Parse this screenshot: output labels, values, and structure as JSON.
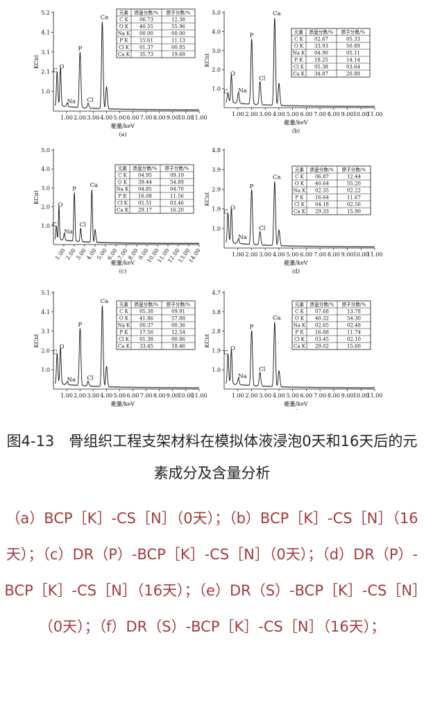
{
  "figure": {
    "title": "图4-13　骨组织工程支架材料在模拟体液浸泡0天和16天后的元素成分及含量分析",
    "subcaption": "（a）BCP［K］-CS［N］（0天）；（b）BCP［K］-CS［N］（16天）；（c）DR（P）-BCP［K］-CS［N］（0天）；（d）DR（P）-BCP［K］-CS［N］（16天）；（e）DR（S）-BCP［K］-CS［N］（0天）；（f）DR（S）-BCP［K］-CS［N］（16天）；"
  },
  "colors": {
    "ink": "#111111",
    "caption_sub": "#a33a3e",
    "caption_title": "#222222"
  },
  "chart_data": [
    {
      "type": "line",
      "panel": "(a)",
      "ylabel": "KCnt",
      "xlabel": "能量/keV",
      "yticks": [
        "5.2",
        "4.1",
        "3.1",
        "2.1",
        "1.0"
      ],
      "ylim": [
        0,
        5.2
      ],
      "xticks": [
        "1.00",
        "2.00",
        "3.00",
        "4.00",
        "5.00",
        "6.00",
        "7.00",
        "8.00",
        "9.00",
        "10.00",
        "11.00"
      ],
      "xlim": [
        0,
        11
      ],
      "peaks": [
        {
          "label": "C",
          "x": 0.28,
          "y": 1.9
        },
        {
          "label": "O",
          "x": 0.53,
          "y": 2.1
        },
        {
          "label": "Na",
          "x": 1.04,
          "y": 0.28
        },
        {
          "label": "P",
          "x": 2.01,
          "y": 3.05
        },
        {
          "label": "Cl",
          "x": 2.62,
          "y": 0.35
        },
        {
          "label": "Ca",
          "x": 3.69,
          "y": 4.7
        }
      ],
      "table": {
        "headers": [
          "元素",
          "质量分数/%",
          "原子分数/%"
        ],
        "rows": [
          [
            "C K",
            "06.73",
            "12.38"
          ],
          [
            "O K",
            "40.55",
            "55.96"
          ],
          [
            "Na K",
            "00.00",
            "00.00"
          ],
          [
            "P K",
            "15.61",
            "11.13"
          ],
          [
            "Cl K",
            "01.37",
            "00.85"
          ],
          [
            "Ca K",
            "35.73",
            "19.68"
          ]
        ]
      }
    },
    {
      "type": "line",
      "panel": "(b)",
      "ylabel": "KCnt",
      "xlabel": "能量/keV",
      "yticks": [
        "5.0",
        "4.0",
        "3.0",
        "2.0",
        "1.0"
      ],
      "ylim": [
        0,
        5.0
      ],
      "xticks": [
        "1.00",
        "2.00",
        "3.00",
        "4.00",
        "5.00",
        "6.00",
        "7.00",
        "8.00",
        "9.00",
        "10.00",
        "11.00"
      ],
      "xlim": [
        0,
        11
      ],
      "peaks": [
        {
          "label": "C",
          "x": 0.28,
          "y": 0.6
        },
        {
          "label": "O",
          "x": 0.53,
          "y": 1.55
        },
        {
          "label": "Na",
          "x": 1.04,
          "y": 0.65
        },
        {
          "label": "P",
          "x": 2.01,
          "y": 3.55
        },
        {
          "label": "Cl",
          "x": 2.62,
          "y": 1.3
        },
        {
          "label": "Ca",
          "x": 3.69,
          "y": 4.7
        }
      ],
      "table": {
        "headers": [
          "元素",
          "质量分数/%",
          "原子分数/%"
        ],
        "rows": [
          [
            "C K",
            "02.67",
            "05.33"
          ],
          [
            "O K",
            "33.93",
            "50.89"
          ],
          [
            "Na K",
            "04.90",
            "05.11"
          ],
          [
            "P K",
            "18.25",
            "14.14"
          ],
          [
            "Cl K",
            "05.38",
            "03.64"
          ],
          [
            "Ca K",
            "34.87",
            "20.88"
          ]
        ]
      }
    },
    {
      "type": "line",
      "panel": "(c)",
      "ylabel": "KCnt",
      "xlabel": "能量/keV",
      "yticks": [
        "5.0",
        "4.0",
        "3.0",
        "2.0",
        "1.0"
      ],
      "ylim": [
        0,
        5.0
      ],
      "xticks": [
        "1.00",
        "2.00",
        "3.00",
        "4.00",
        "5.00",
        "6.00",
        "7.00",
        "8.00",
        "9.00",
        "10.00",
        "11.00",
        "12.00",
        "13.00",
        "14.00"
      ],
      "xlim": [
        0,
        14
      ],
      "peaks": [
        {
          "label": "C",
          "x": 0.28,
          "y": 0.8
        },
        {
          "label": "O",
          "x": 0.53,
          "y": 1.85
        },
        {
          "label": "Na",
          "x": 1.04,
          "y": 0.45
        },
        {
          "label": "P",
          "x": 2.01,
          "y": 2.7
        },
        {
          "label": "Cl",
          "x": 2.62,
          "y": 0.8
        },
        {
          "label": "Ca",
          "x": 3.69,
          "y": 2.9
        }
      ],
      "table": {
        "headers": [
          "元素",
          "质量分数/%",
          "原子分数/%"
        ],
        "rows": [
          [
            "C K",
            "04.95",
            "09.19"
          ],
          [
            "O K",
            "39.44",
            "54.89"
          ],
          [
            "Na K",
            "04.85",
            "04.70"
          ],
          [
            "P K",
            "16.08",
            "11.56"
          ],
          [
            "Cl K",
            "05.51",
            "03.46"
          ],
          [
            "Ca K",
            "29.17",
            "16.20"
          ]
        ]
      }
    },
    {
      "type": "line",
      "panel": "(d)",
      "ylabel": "KCnt",
      "xlabel": "能量/keV",
      "yticks": [
        "4.8",
        "3.9",
        "2.9",
        "1.9",
        "1.0"
      ],
      "ylim": [
        0,
        4.8
      ],
      "xticks": [
        "1.00",
        "2.00",
        "3.00",
        "4.00",
        "5.00",
        "6.00",
        "7.00",
        "8.00",
        "9.00",
        "10.00",
        "11.00"
      ],
      "xlim": [
        0,
        11
      ],
      "peaks": [
        {
          "label": "C",
          "x": 0.28,
          "y": 1.55
        },
        {
          "label": "O",
          "x": 0.53,
          "y": 1.75
        },
        {
          "label": "Na",
          "x": 1.04,
          "y": 0.3
        },
        {
          "label": "P",
          "x": 2.01,
          "y": 2.8
        },
        {
          "label": "Cl",
          "x": 2.62,
          "y": 0.75
        },
        {
          "label": "Ca",
          "x": 3.69,
          "y": 3.25
        }
      ],
      "table": {
        "headers": [
          "元素",
          "质量分数/%",
          "原子分数/%"
        ],
        "rows": [
          [
            "C K",
            "06.87",
            "12.44"
          ],
          [
            "O K",
            "40.64",
            "55.20"
          ],
          [
            "Na K",
            "02.35",
            "02.22"
          ],
          [
            "P K",
            "16.64",
            "11.67"
          ],
          [
            "Cl K",
            "04.18",
            "02.56"
          ],
          [
            "Ca K",
            "29.33",
            "15.90"
          ]
        ]
      }
    },
    {
      "type": "line",
      "panel": "(e)",
      "ylabel": "KCnt",
      "xlabel": "能量/keV",
      "yticks": [
        "5.1",
        "4.1",
        "3.1",
        "2.0",
        "1.0"
      ],
      "ylim": [
        0,
        5.1
      ],
      "xticks": [
        "1.00",
        "2.00",
        "3.00",
        "4.00",
        "5.00",
        "6.00",
        "7.00",
        "8.00",
        "9.00",
        "10.00",
        "11.00"
      ],
      "xlim": [
        0,
        11
      ],
      "peaks": [
        {
          "label": "C",
          "x": 0.28,
          "y": 1.7
        },
        {
          "label": "O",
          "x": 0.53,
          "y": 2.0
        },
        {
          "label": "Na",
          "x": 1.04,
          "y": 0.25
        },
        {
          "label": "P",
          "x": 2.01,
          "y": 3.15
        },
        {
          "label": "Cl",
          "x": 2.62,
          "y": 0.35
        },
        {
          "label": "Ca",
          "x": 3.69,
          "y": 4.4
        }
      ],
      "table": {
        "headers": [
          "元素",
          "质量分数/%",
          "原子分数/%"
        ],
        "rows": [
          [
            "C K",
            "05.38",
            "09.91"
          ],
          [
            "O K",
            "41.86",
            "57.88"
          ],
          [
            "Na K",
            "00.37",
            "00.36"
          ],
          [
            "P K",
            "17.56",
            "12.54"
          ],
          [
            "Cl K",
            "01.38",
            "00.86"
          ],
          [
            "Ca K",
            "33.45",
            "18.46"
          ]
        ]
      }
    },
    {
      "type": "line",
      "panel": "(f)",
      "ylabel": "KCnt",
      "xlabel": "能量/keV",
      "yticks": [
        "4.7",
        "3.8",
        "2.8",
        "1.9",
        "1.0"
      ],
      "ylim": [
        0,
        4.7
      ],
      "xticks": [
        "1.00",
        "2.00",
        "3.00",
        "4.00",
        "5.00",
        "6.00",
        "7.00",
        "8.00",
        "9.00",
        "10.00",
        "11.00"
      ],
      "xlim": [
        0,
        11
      ],
      "peaks": [
        {
          "label": "C",
          "x": 0.28,
          "y": 1.55
        },
        {
          "label": "O",
          "x": 0.53,
          "y": 1.75
        },
        {
          "label": "Na",
          "x": 1.04,
          "y": 0.4
        },
        {
          "label": "P",
          "x": 2.01,
          "y": 2.8
        },
        {
          "label": "Cl",
          "x": 2.62,
          "y": 0.75
        },
        {
          "label": "Ca",
          "x": 3.69,
          "y": 3.25
        }
      ],
      "table": {
        "headers": [
          "元素",
          "质量分数/%",
          "原子分数/%"
        ],
        "rows": [
          [
            "C K",
            "07.68",
            "13.78"
          ],
          [
            "O K",
            "40.32",
            "54.30"
          ],
          [
            "Na K",
            "02.65",
            "02.48"
          ],
          [
            "P K",
            "16.88",
            "11.74"
          ],
          [
            "Cl K",
            "03.45",
            "02.10"
          ],
          [
            "Ca K",
            "29.02",
            "15.60"
          ]
        ]
      }
    }
  ]
}
